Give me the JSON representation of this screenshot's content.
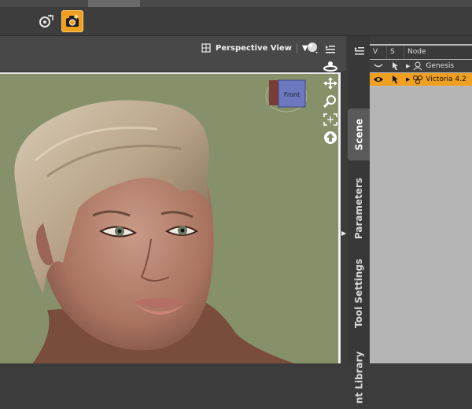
{
  "toolbar": {
    "buttons": [
      {
        "name": "rotate-tool",
        "icon": "rotate-icon",
        "active": false
      },
      {
        "name": "camera-tool",
        "icon": "camera-icon",
        "active": true
      }
    ],
    "accent": "#f0a020"
  },
  "viewport": {
    "view_label": "Perspective View",
    "cube_label": "Front",
    "background": "#86916a"
  },
  "side_tabs": [
    {
      "label": "Scene",
      "active": true
    },
    {
      "label": "Parameters",
      "active": false
    },
    {
      "label": "Tool Settings",
      "active": false
    },
    {
      "label": "nt Library",
      "active": false
    }
  ],
  "scene": {
    "columns": [
      "V",
      "S",
      "Node"
    ],
    "rows": [
      {
        "name": "Genesis",
        "selected": false
      },
      {
        "name": "Victoria 4.2",
        "selected": true
      }
    ]
  }
}
